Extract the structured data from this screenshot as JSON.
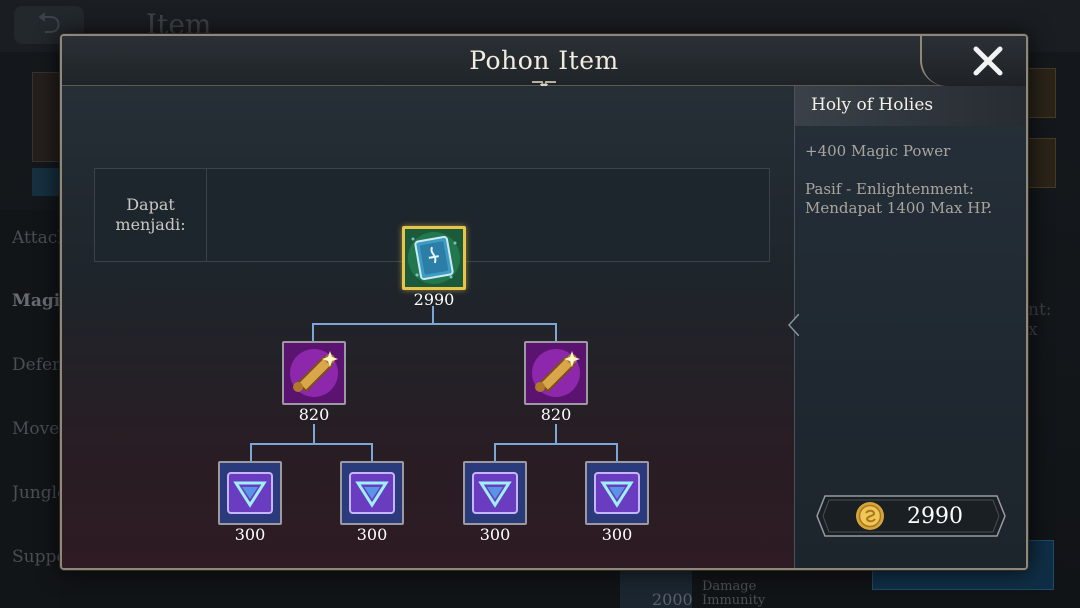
{
  "background": {
    "screen_title": "Item",
    "categories": [
      "Attack",
      "Magic",
      "Defense",
      "Movement",
      "Jungle",
      "Support"
    ],
    "right_text": "nt:\nx",
    "bottom_price": "2000",
    "bottom_label": "Damage\nImmunity"
  },
  "modal": {
    "title": "Pohon Item",
    "upgrade_label": "Dapat menjadi:",
    "close_icon": "close-x-icon"
  },
  "tree": {
    "root": {
      "name": "Holy of Holies",
      "price": "2990",
      "icon": "holy-book-icon",
      "selected": true
    },
    "tier2": [
      {
        "price": "820",
        "icon": "magic-scroll-icon"
      },
      {
        "price": "820",
        "icon": "magic-scroll-icon"
      }
    ],
    "tier3": [
      {
        "price": "300",
        "icon": "mystery-codex-icon"
      },
      {
        "price": "300",
        "icon": "mystery-codex-icon"
      },
      {
        "price": "300",
        "icon": "mystery-codex-icon"
      },
      {
        "price": "300",
        "icon": "mystery-codex-icon"
      }
    ]
  },
  "detail": {
    "name": "Holy of Holies",
    "stat": "+400 Magic Power",
    "passive": "Pasif - Enlightenment: Mendapat 1400 Max HP.",
    "price": "2990",
    "price_icon": "gold-coin-icon"
  },
  "colors": {
    "selected_border": "#e7c44a",
    "connector": "#7aa8d6",
    "frame": "#8f877a"
  }
}
